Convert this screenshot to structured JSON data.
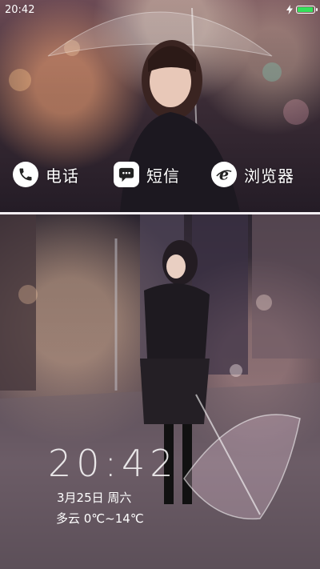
{
  "status_bar": {
    "time": "20:42",
    "battery_level": 1.0
  },
  "dock": {
    "items": [
      {
        "label": "电话",
        "icon": "phone-icon"
      },
      {
        "label": "短信",
        "icon": "message-icon"
      },
      {
        "label": "浏览器",
        "icon": "browser-icon"
      }
    ]
  },
  "lock_screen": {
    "time": "20:42",
    "date": "3月25日  周六",
    "weather": "多云 0℃~14℃"
  },
  "colors": {
    "battery_fill": "#34e05a",
    "divider": "#f3eef2"
  }
}
